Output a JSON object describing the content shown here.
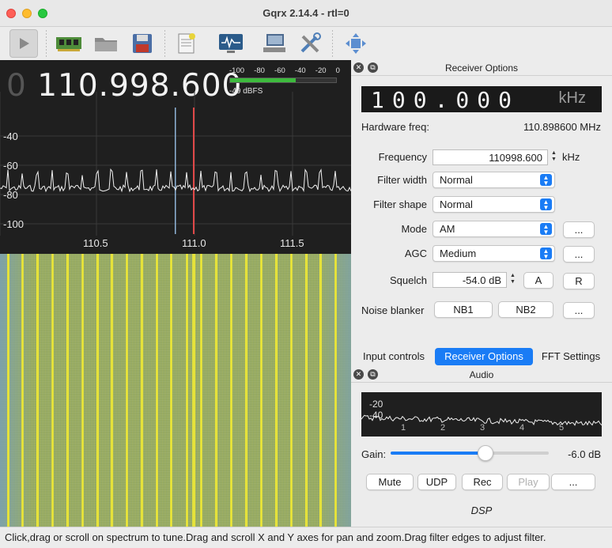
{
  "window": {
    "title": "Gqrx 2.14.4 - rtl=0"
  },
  "toolbar": {
    "items": [
      {
        "icon": "play-icon"
      },
      {
        "icon": "hardware-card-icon"
      },
      {
        "icon": "folder-icon"
      },
      {
        "icon": "save-icon"
      },
      {
        "icon": "document-icon"
      },
      {
        "icon": "monitor-waveform-icon"
      },
      {
        "icon": "network-computer-icon"
      },
      {
        "icon": "tools-icon"
      },
      {
        "icon": "move-arrows-icon"
      }
    ]
  },
  "spectrum": {
    "freq_leading": "0",
    "freq_display": "110.998.600",
    "meter_scale": [
      "-100",
      "-80",
      "-60",
      "-40",
      "-20",
      "0"
    ],
    "meter_level_fraction": 0.62,
    "meter_value": "-49 dBFS",
    "y_ticks": [
      "-40",
      "-60",
      "-80",
      "-100"
    ],
    "x_ticks": [
      "110.5",
      "111.0",
      "111.5"
    ]
  },
  "receiver": {
    "title": "Receiver Options",
    "lcd_value": "100.000",
    "lcd_unit": "kHz",
    "hw_label": "Hardware freq:",
    "hw_value": "110.898600 MHz",
    "freq_label": "Frequency",
    "freq_value": "110998.600",
    "freq_unit": "kHz",
    "filter_width_label": "Filter width",
    "filter_width": "Normal",
    "filter_shape_label": "Filter shape",
    "filter_shape": "Normal",
    "mode_label": "Mode",
    "mode": "AM",
    "agc_label": "AGC",
    "agc": "Medium",
    "squelch_label": "Squelch",
    "squelch_value": "-54.0 dB",
    "squelch_a": "A",
    "squelch_r": "R",
    "nb_label": "Noise blanker",
    "nb1": "NB1",
    "nb2": "NB2",
    "more": "..."
  },
  "tabs": [
    {
      "label": "Input controls"
    },
    {
      "label": "Receiver Options",
      "active": true
    },
    {
      "label": "FFT Settings"
    }
  ],
  "audio": {
    "title": "Audio",
    "y_ticks": [
      "-20",
      "-40"
    ],
    "x_ticks": [
      "1",
      "2",
      "3",
      "4",
      "5"
    ],
    "gain_label": "Gain:",
    "gain_value": "-6.0 dB",
    "gain_fraction": 0.6,
    "mute": "Mute",
    "udp": "UDP",
    "rec": "Rec",
    "play": "Play",
    "more": "...",
    "dsp": "DSP"
  },
  "status": {
    "text": "Click,drag or scroll on spectrum to tune.Drag and scroll X and Y axes for pan and zoom.Drag filter edges to adjust filter."
  },
  "colors": {
    "accent": "#1a7cf5",
    "waterfall_line": "#e5e23a",
    "meter": "#3dbb3d"
  }
}
